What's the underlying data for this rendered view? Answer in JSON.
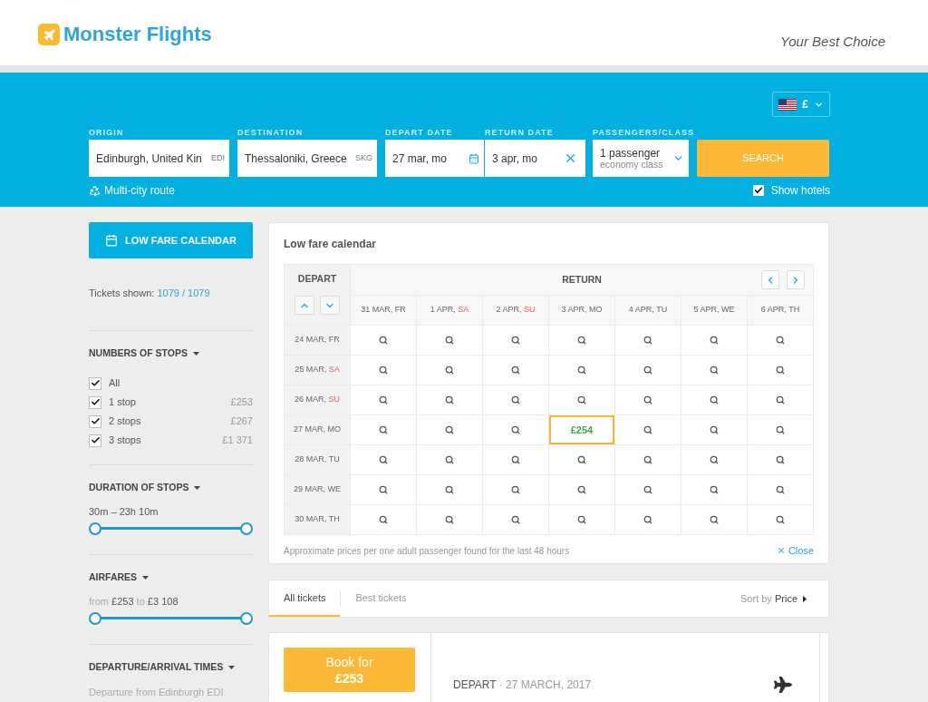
{
  "header": {
    "logo": "Monster Flights",
    "tagline": "Your Best Choice"
  },
  "search": {
    "currency": "£",
    "fields": [
      {
        "kind": "place",
        "label": "ORIGIN",
        "value": "Edinburgh, United Kin",
        "code": "EDI"
      },
      {
        "kind": "place",
        "label": "DESTINATION",
        "value": "Thessaloniki, Greece",
        "code": "SKG"
      },
      {
        "kind": "date",
        "label": "DEPART DATE",
        "value": "27 mar, mo"
      },
      {
        "kind": "clearable",
        "label": "RETURN DATE",
        "value": "3 apr, mo"
      },
      {
        "kind": "select",
        "label": "PASSENGERS/CLASS",
        "value": "1 passenger",
        "detail": "economy class"
      }
    ],
    "button": "SEARCH",
    "multi_city": "Multi-city route",
    "show_hotels": {
      "label": "Show hotels",
      "checked": true
    }
  },
  "sidebar": {
    "calendar_button": "LOW FARE CALENDAR",
    "tickets_shown": {
      "label": "Tickets shown:",
      "count": "1079 / 1079"
    },
    "filters": [
      {
        "kind": "checklist",
        "title": "NUMBERS OF STOPS",
        "items": [
          {
            "label": "All",
            "checked": true
          },
          {
            "label": "1 stop",
            "price": "£253",
            "checked": true
          },
          {
            "label": "2 stops",
            "price": "£267",
            "checked": true
          },
          {
            "label": "3 stops",
            "price": "£1 371",
            "checked": true
          }
        ]
      },
      {
        "kind": "range",
        "title": "DURATION OF STOPS",
        "reading": [
          {
            "text": "30m – 23h 10m",
            "muted": false
          }
        ],
        "handles": [
          {
            "level": 0
          },
          {
            "level": 1
          }
        ]
      },
      {
        "kind": "range",
        "title": "AIRFARES",
        "reading": [
          {
            "text": "from",
            "muted": true
          },
          {
            "text": "£253",
            "muted": false
          },
          {
            "text": "to",
            "muted": true
          },
          {
            "text": "£3 108",
            "muted": false
          }
        ],
        "handles": [
          {
            "level": 0
          },
          {
            "level": 1
          }
        ]
      },
      {
        "kind": "times",
        "title": "DEPARTURE/ARRIVAL TIMES",
        "text": "Departure from Edinburgh EDI"
      }
    ]
  },
  "calendar": {
    "title": "Low fare calendar",
    "depart_heading": "DEPART",
    "return_heading": "RETURN",
    "columns": [
      {
        "date": "31 MAR,",
        "day": "FR",
        "weekend": false
      },
      {
        "date": "1 APR,",
        "day": "SA",
        "weekend": true
      },
      {
        "date": "2 APR,",
        "day": "SU",
        "weekend": true
      },
      {
        "date": "3 APR,",
        "day": "MO",
        "weekend": false
      },
      {
        "date": "4 APR,",
        "day": "TU",
        "weekend": false
      },
      {
        "date": "5 APR,",
        "day": "WE",
        "weekend": false
      },
      {
        "date": "6 APR,",
        "day": "TH",
        "weekend": false
      }
    ],
    "rows": [
      {
        "date": "24 MAR,",
        "day": "FR",
        "weekend": false,
        "cells": [
          {
            "kind": "search",
            "selected": false
          },
          {
            "kind": "search",
            "selected": false
          },
          {
            "kind": "search",
            "selected": false
          },
          {
            "kind": "search",
            "selected": false
          },
          {
            "kind": "search",
            "selected": false
          },
          {
            "kind": "search",
            "selected": false
          },
          {
            "kind": "search",
            "selected": false
          }
        ]
      },
      {
        "date": "25 MAR,",
        "day": "SA",
        "weekend": true,
        "cells": [
          {
            "kind": "search",
            "selected": false
          },
          {
            "kind": "search",
            "selected": false
          },
          {
            "kind": "search",
            "selected": false
          },
          {
            "kind": "search",
            "selected": false
          },
          {
            "kind": "search",
            "selected": false
          },
          {
            "kind": "search",
            "selected": false
          },
          {
            "kind": "search",
            "selected": false
          }
        ]
      },
      {
        "date": "26 MAR,",
        "day": "SU",
        "weekend": true,
        "cells": [
          {
            "kind": "search",
            "selected": false
          },
          {
            "kind": "search",
            "selected": false
          },
          {
            "kind": "search",
            "selected": false
          },
          {
            "kind": "search",
            "selected": false
          },
          {
            "kind": "search",
            "selected": false
          },
          {
            "kind": "search",
            "selected": false
          },
          {
            "kind": "search",
            "selected": false
          }
        ]
      },
      {
        "date": "27 MAR,",
        "day": "MO",
        "weekend": false,
        "cells": [
          {
            "kind": "search",
            "selected": false
          },
          {
            "kind": "search",
            "selected": false
          },
          {
            "kind": "search",
            "selected": false
          },
          {
            "kind": "price",
            "price": "£254",
            "selected": true
          },
          {
            "kind": "search",
            "selected": false
          },
          {
            "kind": "search",
            "selected": false
          },
          {
            "kind": "search",
            "selected": false
          }
        ]
      },
      {
        "date": "28 MAR,",
        "day": "TU",
        "weekend": false,
        "cells": [
          {
            "kind": "search",
            "selected": false
          },
          {
            "kind": "search",
            "selected": false
          },
          {
            "kind": "search",
            "selected": false
          },
          {
            "kind": "search",
            "selected": false
          },
          {
            "kind": "search",
            "selected": false
          },
          {
            "kind": "search",
            "selected": false
          },
          {
            "kind": "search",
            "selected": false
          }
        ]
      },
      {
        "date": "29 MAR,",
        "day": "WE",
        "weekend": false,
        "cells": [
          {
            "kind": "search",
            "selected": false
          },
          {
            "kind": "search",
            "selected": false
          },
          {
            "kind": "search",
            "selected": false
          },
          {
            "kind": "search",
            "selected": false
          },
          {
            "kind": "search",
            "selected": false
          },
          {
            "kind": "search",
            "selected": false
          },
          {
            "kind": "search",
            "selected": false
          }
        ]
      },
      {
        "date": "30 MAR,",
        "day": "TH",
        "weekend": false,
        "cells": [
          {
            "kind": "search",
            "selected": false
          },
          {
            "kind": "search",
            "selected": false
          },
          {
            "kind": "search",
            "selected": false
          },
          {
            "kind": "search",
            "selected": false
          },
          {
            "kind": "search",
            "selected": false
          },
          {
            "kind": "search",
            "selected": false
          },
          {
            "kind": "search",
            "selected": false
          }
        ]
      }
    ],
    "note": "Approximate prices per one adult passenger found for the last 48 hours",
    "close": "Close"
  },
  "results": {
    "tabs": [
      {
        "label": "All tickets",
        "selected": true
      },
      {
        "label": "Best tickets",
        "selected": false
      }
    ],
    "sort": {
      "label": "Sort by",
      "value": "Price"
    },
    "ticket": {
      "book": "Book for",
      "price": "£253",
      "depart": "DEPART",
      "date": "· 27 MARCH, 2017"
    }
  }
}
